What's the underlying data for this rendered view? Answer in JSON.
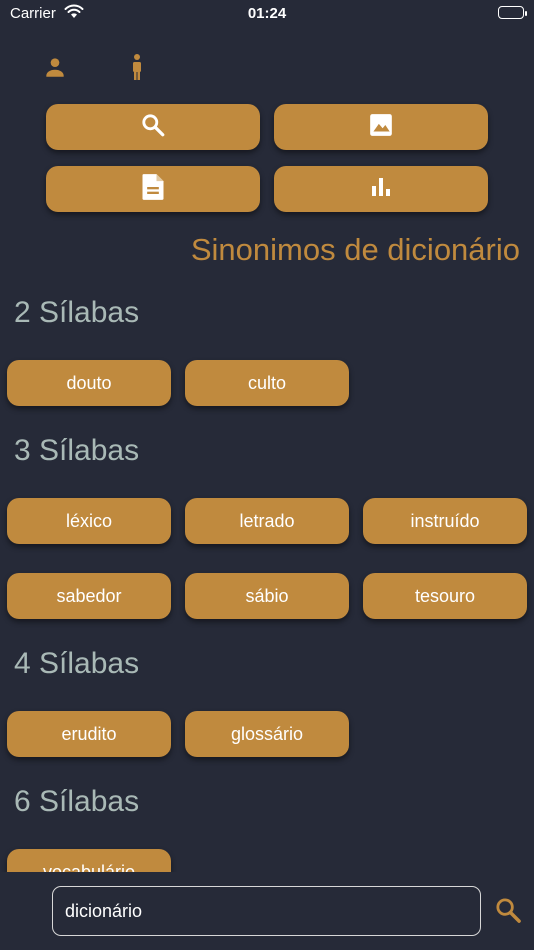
{
  "status_bar": {
    "carrier": "Carrier",
    "time": "01:24"
  },
  "toolbar": {
    "icons": [
      "person-icon",
      "accessibility-icon"
    ],
    "buttons": [
      "search-icon",
      "image-icon",
      "document-icon",
      "bar-chart-icon"
    ]
  },
  "title": "Sinonimos de dicionário",
  "sections": [
    {
      "heading": "2 Sílabas",
      "words": [
        "douto",
        "culto"
      ]
    },
    {
      "heading": "3 Sílabas",
      "words": [
        "léxico",
        "letrado",
        "instruído",
        "sabedor",
        "sábio",
        "tesouro"
      ]
    },
    {
      "heading": "4 Sílabas",
      "words": [
        "erudito",
        "glossário"
      ]
    },
    {
      "heading": "6 Sílabas",
      "words": [
        "vocabulário"
      ]
    }
  ],
  "search": {
    "value": "dicionário"
  },
  "colors": {
    "background": "#262a38",
    "accent": "#c08a3e",
    "section_text": "#a9b9b6"
  }
}
